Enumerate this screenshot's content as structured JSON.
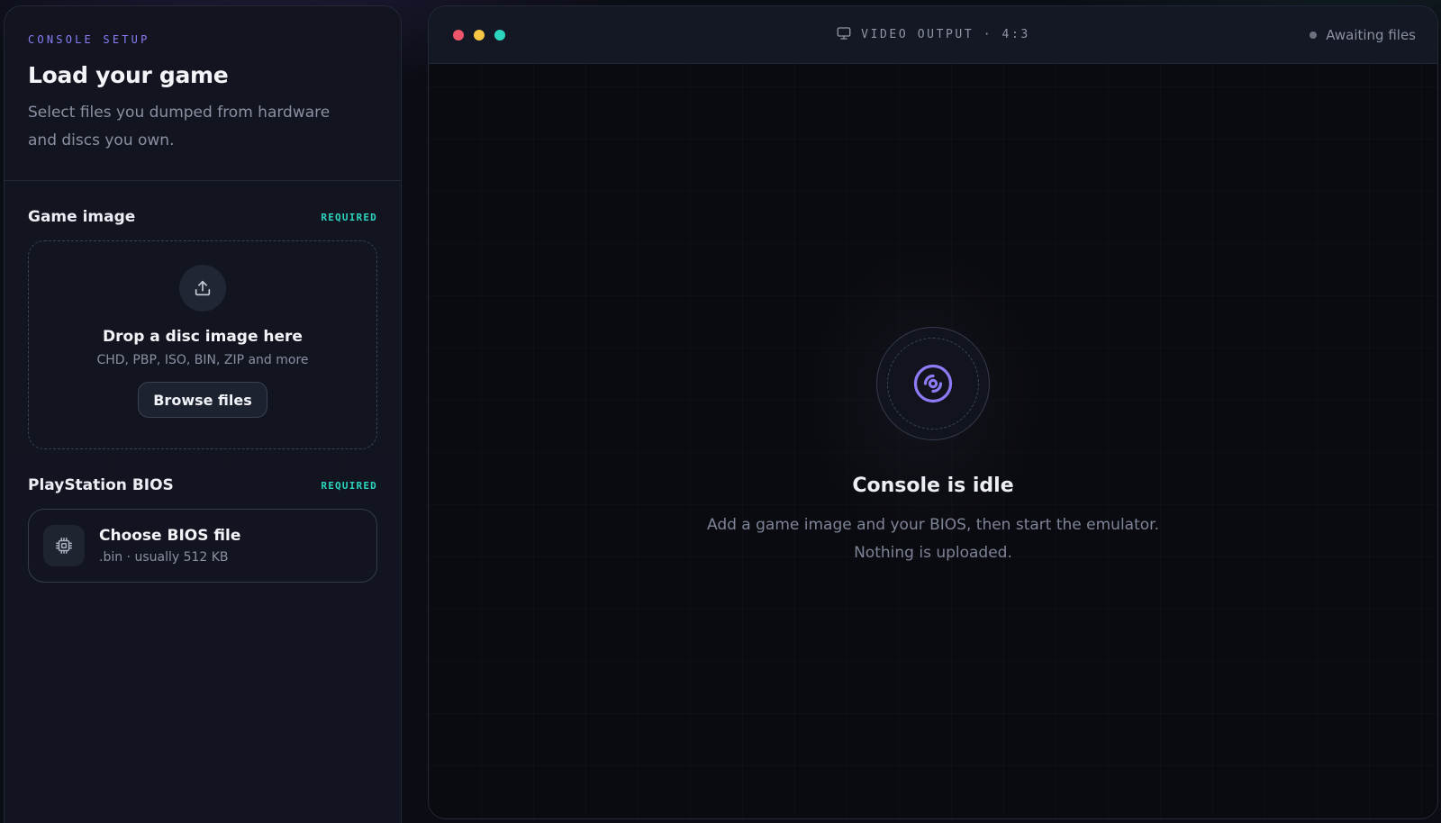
{
  "sidebar": {
    "eyebrow": "CONSOLE SETUP",
    "title": "Load your game",
    "subtitle": "Select files you dumped from hardware and discs you own.",
    "game_image": {
      "title": "Game image",
      "badge": "REQUIRED",
      "icon": "upload-icon",
      "drop_title": "Drop a disc image here",
      "formats": "CHD, PBP, ISO, BIN, ZIP and more",
      "browse_label": "Browse files"
    },
    "bios": {
      "title": "PlayStation BIOS",
      "badge": "REQUIRED",
      "icon": "chip-icon",
      "card_title": "Choose BIOS file",
      "card_subtitle": ".bin · usually 512 KB"
    }
  },
  "video": {
    "title": "VIDEO OUTPUT · 4:3",
    "title_icon": "monitor-icon",
    "status": "Awaiting files",
    "window_dots": [
      "#f0566b",
      "#f6c744",
      "#2dd4bf"
    ],
    "idle": {
      "icon": "disc-icon",
      "title": "Console is idle",
      "line1": "Add a game image and your BIOS, then start the emulator.",
      "line2": "Nothing is uploaded."
    }
  },
  "colors": {
    "accent": "#8b7cf6",
    "required": "#2dd4bf"
  }
}
